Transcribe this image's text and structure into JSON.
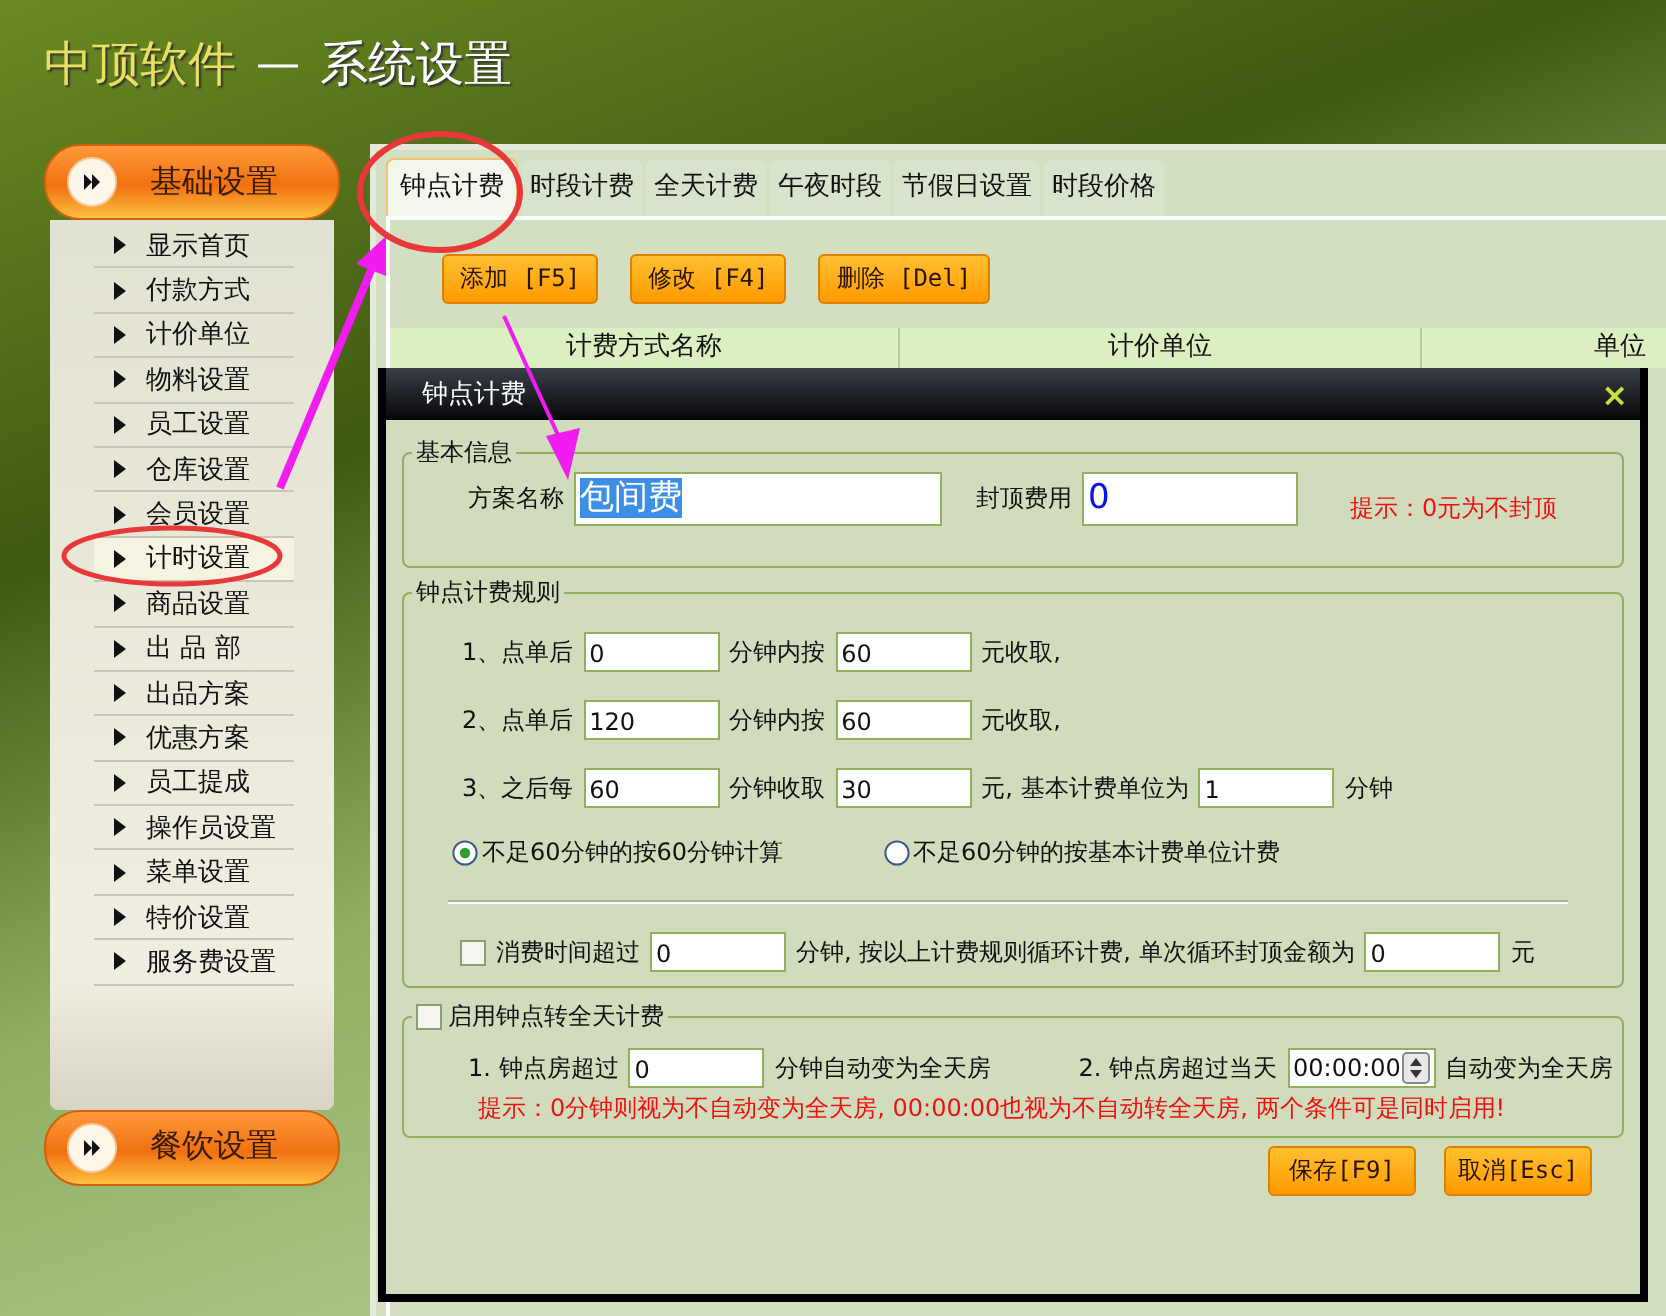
{
  "title": {
    "brand": "中顶软件",
    "separator": "—",
    "page": "系统设置"
  },
  "sidebar": {
    "groups": [
      {
        "label": "基础设置",
        "expanded": true,
        "items": [
          {
            "label": "显示首页",
            "selected": false
          },
          {
            "label": "付款方式",
            "selected": false
          },
          {
            "label": "计价单位",
            "selected": false
          },
          {
            "label": "物料设置",
            "selected": false
          },
          {
            "label": "员工设置",
            "selected": false
          },
          {
            "label": "仓库设置",
            "selected": false
          },
          {
            "label": "会员设置",
            "selected": false
          },
          {
            "label": "计时设置",
            "selected": true
          },
          {
            "label": "商品设置",
            "selected": false
          },
          {
            "label": "出 品 部",
            "selected": false
          },
          {
            "label": "出品方案",
            "selected": false
          },
          {
            "label": "优惠方案",
            "selected": false
          },
          {
            "label": "员工提成",
            "selected": false
          },
          {
            "label": "操作员设置",
            "selected": false
          },
          {
            "label": "菜单设置",
            "selected": false
          },
          {
            "label": "特价设置",
            "selected": false
          },
          {
            "label": "服务费设置",
            "selected": false
          }
        ]
      },
      {
        "label": "餐饮设置",
        "expanded": false
      }
    ]
  },
  "tabs": [
    {
      "label": "钟点计费",
      "selected": true
    },
    {
      "label": "时段计费",
      "selected": false
    },
    {
      "label": "全天计费",
      "selected": false
    },
    {
      "label": "午夜时段",
      "selected": false
    },
    {
      "label": "节假日设置",
      "selected": false
    },
    {
      "label": "时段价格",
      "selected": false
    }
  ],
  "toolbar": [
    "添加 [F5]",
    "修改 [F4]",
    "删除 [Del]"
  ],
  "table": {
    "columns": [
      "计费方式名称",
      "计价单位",
      "单位"
    ]
  },
  "dialog": {
    "title": "钟点计费",
    "close": "×",
    "basic": {
      "legend": "基本信息",
      "name_label": "方案名称",
      "name_value": "包间费",
      "name_selected": true,
      "cap_label": "封顶费用",
      "cap_value": "0",
      "hint": "提示：0元为不封顶"
    },
    "rules": {
      "legend": "钟点计费规则",
      "rows": [
        [
          {
            "kind": "text",
            "text": "1、点单后"
          },
          {
            "kind": "input",
            "value": "0"
          },
          {
            "kind": "text",
            "text": "分钟内按"
          },
          {
            "kind": "input",
            "value": "60"
          },
          {
            "kind": "text",
            "text": "元收取,"
          }
        ],
        [
          {
            "kind": "text",
            "text": "2、点单后"
          },
          {
            "kind": "input",
            "value": "120"
          },
          {
            "kind": "text",
            "text": "分钟内按"
          },
          {
            "kind": "input",
            "value": "60"
          },
          {
            "kind": "text",
            "text": "元收取,"
          }
        ],
        [
          {
            "kind": "text",
            "text": "3、之后每"
          },
          {
            "kind": "input",
            "value": "60"
          },
          {
            "kind": "text",
            "text": "分钟收取"
          },
          {
            "kind": "input",
            "value": "30"
          },
          {
            "kind": "text",
            "text": "元, 基本计费单位为"
          },
          {
            "kind": "input",
            "value": "1"
          },
          {
            "kind": "text",
            "text": "分钟"
          }
        ]
      ],
      "options": [
        {
          "label": "不足60分钟的按60分钟计算",
          "selected": true
        },
        {
          "label": "不足60分钟的按基本计费单位计费",
          "selected": false
        }
      ],
      "cycle": {
        "checked": false,
        "parts": [
          {
            "kind": "text",
            "text": "消费时间超过"
          },
          {
            "kind": "input",
            "value": "0"
          },
          {
            "kind": "text",
            "text": "分钟, 按以上计费规则循环计费, 单次循环封顶金额为"
          },
          {
            "kind": "input",
            "value": "0"
          },
          {
            "kind": "text",
            "text": "元"
          }
        ]
      }
    },
    "fullday": {
      "legend": "启用钟点转全天计费",
      "checked": false,
      "parts": [
        {
          "kind": "text",
          "text": "1. 钟点房超过"
        },
        {
          "kind": "input",
          "value": "0"
        },
        {
          "kind": "text",
          "text": "分钟自动变为全天房"
        },
        {
          "kind": "gap"
        },
        {
          "kind": "text",
          "text": "2. 钟点房超过当天"
        },
        {
          "kind": "time",
          "value": "00:00:00"
        },
        {
          "kind": "text",
          "text": "自动变为全天房"
        }
      ],
      "hint": "提示：0分钟则视为不自动变为全天房, 00:00:00也视为不自动转全天房, 两个条件可是同时启用!"
    },
    "buttons": [
      "保存[F9]",
      "取消[Esc]"
    ]
  }
}
